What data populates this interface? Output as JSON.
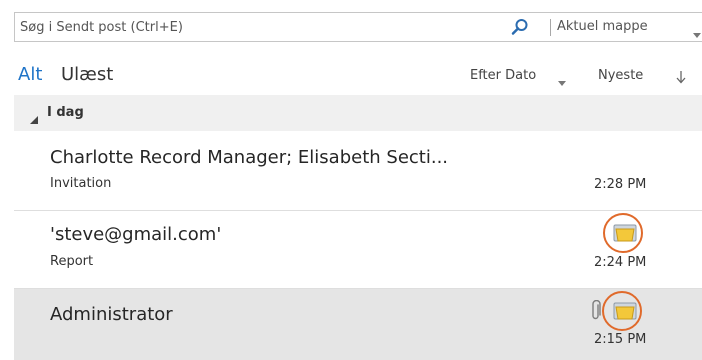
{
  "search": {
    "placeholder": "Søg i Sendt post (Ctrl+E)",
    "scope": "Aktuel mappe",
    "icon": "search-icon"
  },
  "filters": {
    "all": "Alt",
    "unread": "Ulæst",
    "sort_by": "Efter Dato",
    "order": "Nyeste"
  },
  "group": {
    "label": "I dag"
  },
  "messages": [
    {
      "sender": "Charlotte Record Manager; Elisabeth Secti...",
      "subject": "Invitation",
      "time": "2:28 PM"
    },
    {
      "sender": "'steve@gmail.com'",
      "subject": "Report",
      "time": "2:24 PM",
      "icons": [
        "folder-icon"
      ]
    },
    {
      "sender": "Administrator",
      "subject": "",
      "time": "2:15 PM",
      "icons": [
        "paperclip-icon",
        "folder-icon"
      ],
      "selected": true
    }
  ],
  "colors": {
    "accent": "#1f74c8",
    "highlight": "#e06a2b",
    "selected_row": "#e5e5e5",
    "group_header": "#f0f0f0"
  }
}
